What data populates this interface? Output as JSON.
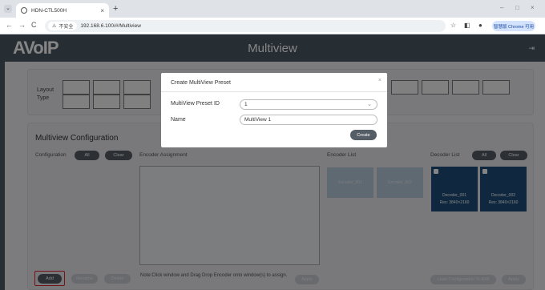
{
  "browser": {
    "tab_title": "HDN-CTL500H",
    "tab_dropdown_icon": "chevron-down-icon",
    "new_tab": "+",
    "close_tab": "×",
    "win_min": "–",
    "win_max": "□",
    "win_close": "×",
    "back": "←",
    "forward": "→",
    "reload": "C",
    "security_label": "不安全",
    "url": "192.168.6.100/#/Multiview",
    "chrome_pill": "智慧版 Chrome 可用"
  },
  "app": {
    "logo": "AVoIP",
    "title": "Multiview",
    "logout_icon": "logout-icon"
  },
  "layout_section": {
    "label": "Layout Type"
  },
  "multiview": {
    "title": "Multiview Configuration",
    "configuration_label": "Configuration",
    "all_label": "All",
    "clear_label": "Clear",
    "encoder_assignment_label": "Encoder Assignment",
    "encoder_list_label": "Encoder List",
    "decoder_list_label": "Decoder List",
    "encoders": [
      "Encoder_001",
      "Encoder_002"
    ],
    "decoders": [
      {
        "name": "Decoder_001",
        "res": "Res: 3840×2160"
      },
      {
        "name": "Decoder_002",
        "res": "Res: 3840×2160"
      }
    ],
    "add_label": "Add",
    "rename_label": "Rename",
    "delete_label": "Delete",
    "note": "Note:Click window and Drag Drop Encoder onto window(s) to assign.",
    "apply_label": "Apply",
    "load_config_label": "Load Configuration To Edit",
    "apply2_label": "Apply"
  },
  "modal": {
    "title": "Create MultiView Preset",
    "close": "×",
    "preset_id_label": "MultiView Preset ID",
    "preset_id_value": "1",
    "name_label": "Name",
    "name_value": "MultiView 1",
    "create_label": "Create"
  }
}
